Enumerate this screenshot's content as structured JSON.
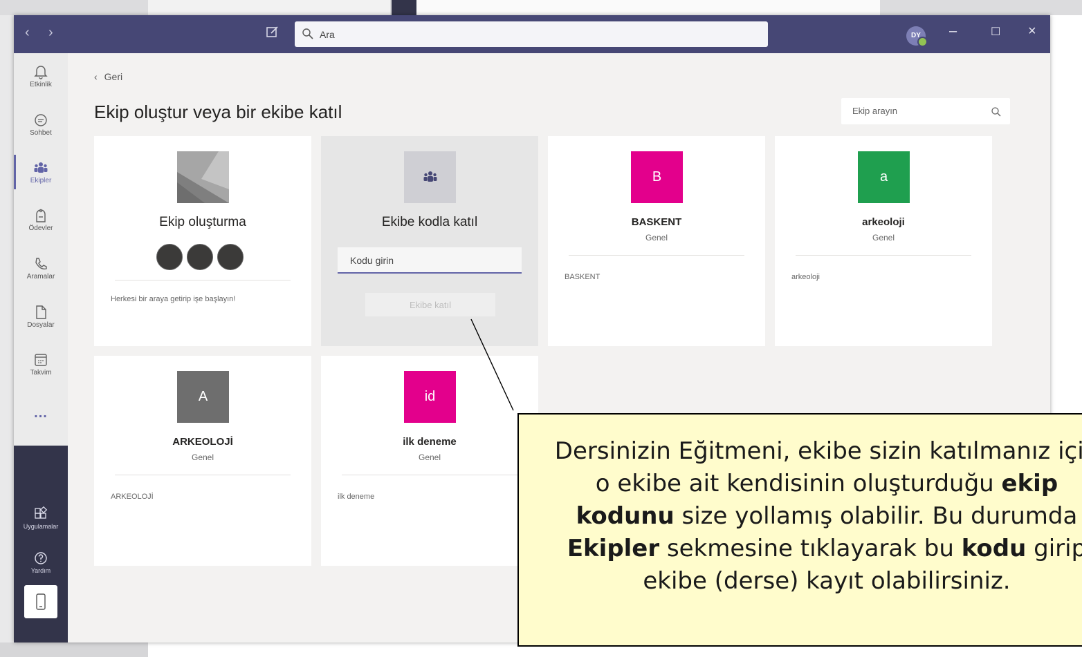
{
  "titlebar": {
    "search_placeholder": "Ara",
    "avatar_initials": "DY"
  },
  "rail": {
    "items": [
      {
        "label": "Etkinlik",
        "icon": "bell-icon"
      },
      {
        "label": "Sohbet",
        "icon": "chat-icon"
      },
      {
        "label": "Ekipler",
        "icon": "teams-icon"
      },
      {
        "label": "Ödevler",
        "icon": "assignments-icon"
      },
      {
        "label": "Aramalar",
        "icon": "phone-icon"
      },
      {
        "label": "Dosyalar",
        "icon": "file-icon"
      },
      {
        "label": "Takvim",
        "icon": "calendar-icon"
      }
    ],
    "more": "...",
    "bottom_items": [
      {
        "label": "Uygulamalar",
        "icon": "apps-icon"
      },
      {
        "label": "Yardım",
        "icon": "help-icon"
      }
    ]
  },
  "main": {
    "back_label": "Geri",
    "title": "Ekip oluştur veya bir ekibe katıl",
    "team_search_placeholder": "Ekip arayın",
    "create_card": {
      "title": "Ekip oluşturma",
      "description": "Herkesi bir araya getirip işe başlayın!"
    },
    "join_card": {
      "title": "Ekibe kodla katıl",
      "input_placeholder": "Kodu girin",
      "button_label": "Ekibe katıl"
    },
    "teams": [
      {
        "initial": "B",
        "name": "BASKENT",
        "channel": "Genel",
        "description": "BASKENT",
        "color": "#e3008c"
      },
      {
        "initial": "a",
        "name": "arkeoloji",
        "channel": "Genel",
        "description": "arkeoloji",
        "color": "#1f9f4f"
      },
      {
        "initial": "A",
        "name": "ARKEOLOJİ",
        "channel": "Genel",
        "description": "ARKEOLOJİ",
        "color": "#6e6e6e"
      },
      {
        "initial": "id",
        "name": "ilk deneme",
        "channel": "Genel",
        "description": "ilk deneme",
        "color": "#e3008c"
      }
    ]
  },
  "callout": {
    "line1": "Dersinizin Eğitmeni, ekibe sizin katılmanız için",
    "line2_pre": "o ekibe ait kendisinin oluşturduğu ",
    "line2_bold": "ekip",
    "line3_bold": "kodunu",
    "line3_post": " size yollamış olabilir. Bu durumda",
    "line4_bold": "Ekipler",
    "line4_mid": " sekmesine tıklayarak bu ",
    "line4_bold2": "kodu",
    "line4_post": " girip",
    "line5": "ekibe (derse) kayıt olabilirsiniz."
  }
}
